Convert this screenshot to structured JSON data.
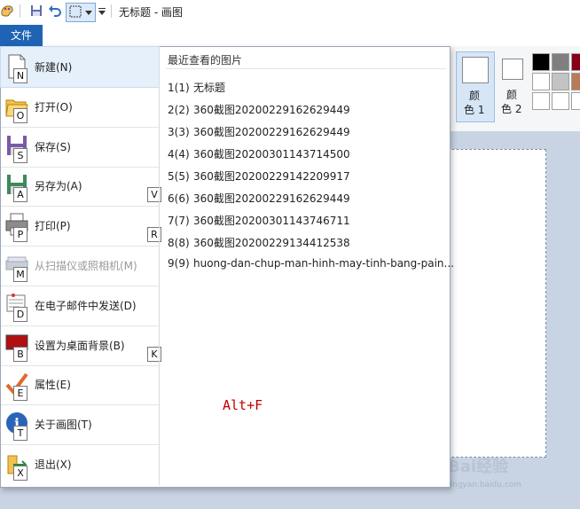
{
  "titlebar": {
    "title": "无标题 - 画图",
    "icons": [
      "paint-app-icon",
      "save-icon",
      "undo-icon",
      "select-icon",
      "quick-access-dropdown-icon"
    ]
  },
  "file_tab": {
    "label": "文件"
  },
  "menu": {
    "items": [
      {
        "label": "新建(N)",
        "key": "N",
        "icon": "new-file-icon"
      },
      {
        "label": "打开(O)",
        "key": "O",
        "icon": "open-folder-icon"
      },
      {
        "label": "保存(S)",
        "key": "S",
        "icon": "save-icon"
      },
      {
        "label": "另存为(A)",
        "key": "A",
        "icon": "save-as-icon",
        "submenu_key": "V"
      },
      {
        "label": "打印(P)",
        "key": "P",
        "icon": "printer-icon",
        "submenu_key": "R"
      },
      {
        "label": "从扫描仪或照相机(M)",
        "key": "M",
        "icon": "scanner-icon",
        "disabled": true
      },
      {
        "label": "在电子邮件中发送(D)",
        "key": "D",
        "icon": "email-icon"
      },
      {
        "label": "设置为桌面背景(B)",
        "key": "B",
        "icon": "desktop-background-icon",
        "submenu_key": "K"
      },
      {
        "label": "属性(E)",
        "key": "E",
        "icon": "properties-icon"
      },
      {
        "label": "关于画图(T)",
        "key": "T",
        "icon": "info-icon"
      },
      {
        "label": "退出(X)",
        "key": "X",
        "icon": "exit-icon"
      }
    ]
  },
  "recent": {
    "title": "最近查看的图片",
    "items": [
      {
        "num": "1(1)",
        "name": "无标题"
      },
      {
        "num": "2(2)",
        "name": "360截图20200229162629449"
      },
      {
        "num": "3(3)",
        "name": "360截图20200229162629449"
      },
      {
        "num": "4(4)",
        "name": "360截图20200301143714500"
      },
      {
        "num": "5(5)",
        "name": "360截图20200229142209917"
      },
      {
        "num": "6(6)",
        "name": "360截图20200229162629449"
      },
      {
        "num": "7(7)",
        "name": "360截图20200301143746711"
      },
      {
        "num": "8(8)",
        "name": "360截图20200229134412538"
      },
      {
        "num": "9(9)",
        "name": "huong-dan-chup-man-hinh-may-tinh-bang-pain..."
      }
    ]
  },
  "hint": {
    "text": "Alt+F"
  },
  "colors": {
    "color1_label": "颜\n色 1",
    "color2_label": "颜\n色 2",
    "color1_label_a": "颜",
    "color1_label_b": "色 1",
    "color2_label_a": "颜",
    "color2_label_b": "色 2",
    "palette": [
      "#000000",
      "#7f7f7f",
      "#880015",
      "#ffffff",
      "#c3c3c3",
      "#b97a57",
      "#ffffff",
      "#ffffff",
      "#ffffff"
    ]
  },
  "watermark": {
    "text": "Bai经验",
    "sub": "jingyan.baidu.com"
  }
}
